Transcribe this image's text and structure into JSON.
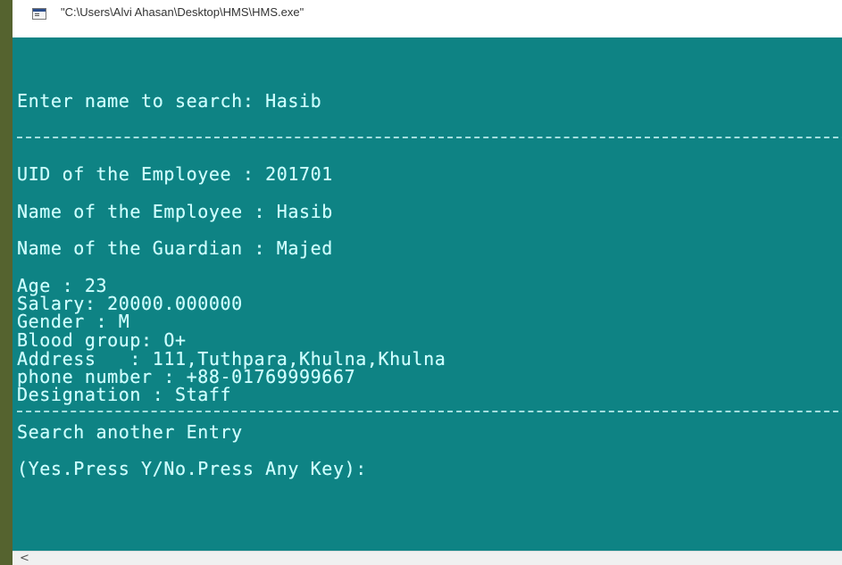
{
  "window": {
    "title": "\"C:\\Users\\Alvi Ahasan\\Desktop\\HMS\\HMS.exe\"",
    "icon": "console-app-icon"
  },
  "console": {
    "background": "#0e8384",
    "text_color": "#ccffff",
    "prompt_search": "Enter name to search: Hasib",
    "uid_line": "UID of the Employee : 201701",
    "name_line": "Name of the Employee : Hasib",
    "guardian_line": "Name of the Guardian : Majed",
    "age_line": "Age : 23",
    "salary_line": "Salary: 20000.000000",
    "gender_line": "Gender : M",
    "blood_line": "Blood group: O+",
    "address_line": "Address   : 111,Tuthpara,Khulna,Khulna",
    "phone_line": "phone number : +88-01769999667",
    "designation_line": "Designation : Staff",
    "search_again_line": "Search another Entry",
    "yes_no_line": "(Yes.Press Y/No.Press Any Key):"
  },
  "scrollbar": {
    "left_arrow": "<"
  }
}
